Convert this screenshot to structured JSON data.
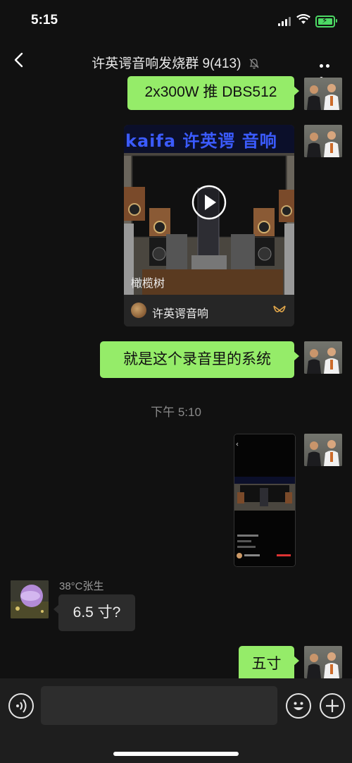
{
  "status_bar": {
    "time": "5:15"
  },
  "header": {
    "title": "许英谔音响发烧群 9(413)"
  },
  "messages": {
    "m1": {
      "text": "2x300W 推 DBS512"
    },
    "video": {
      "sign_text": "kaifa 许英谔 音响",
      "caption": "橄榄树",
      "channel_name": "许英谔音响"
    },
    "m3": {
      "text": "就是这个录音里的系统"
    },
    "timestamp": "下午 5:10",
    "incoming": {
      "sender": "38°C张生",
      "text": "6.5 寸?"
    },
    "m5": {
      "text": "五寸"
    }
  },
  "colors": {
    "bubble_out": "#95ec69",
    "bubble_in": "#2c2c2c",
    "background": "#111111",
    "sign_blue": "#3b5bff"
  },
  "icons": [
    "back-icon",
    "mute-icon",
    "more-icon",
    "play-icon",
    "voice-icon",
    "emoji-icon",
    "plus-icon"
  ]
}
